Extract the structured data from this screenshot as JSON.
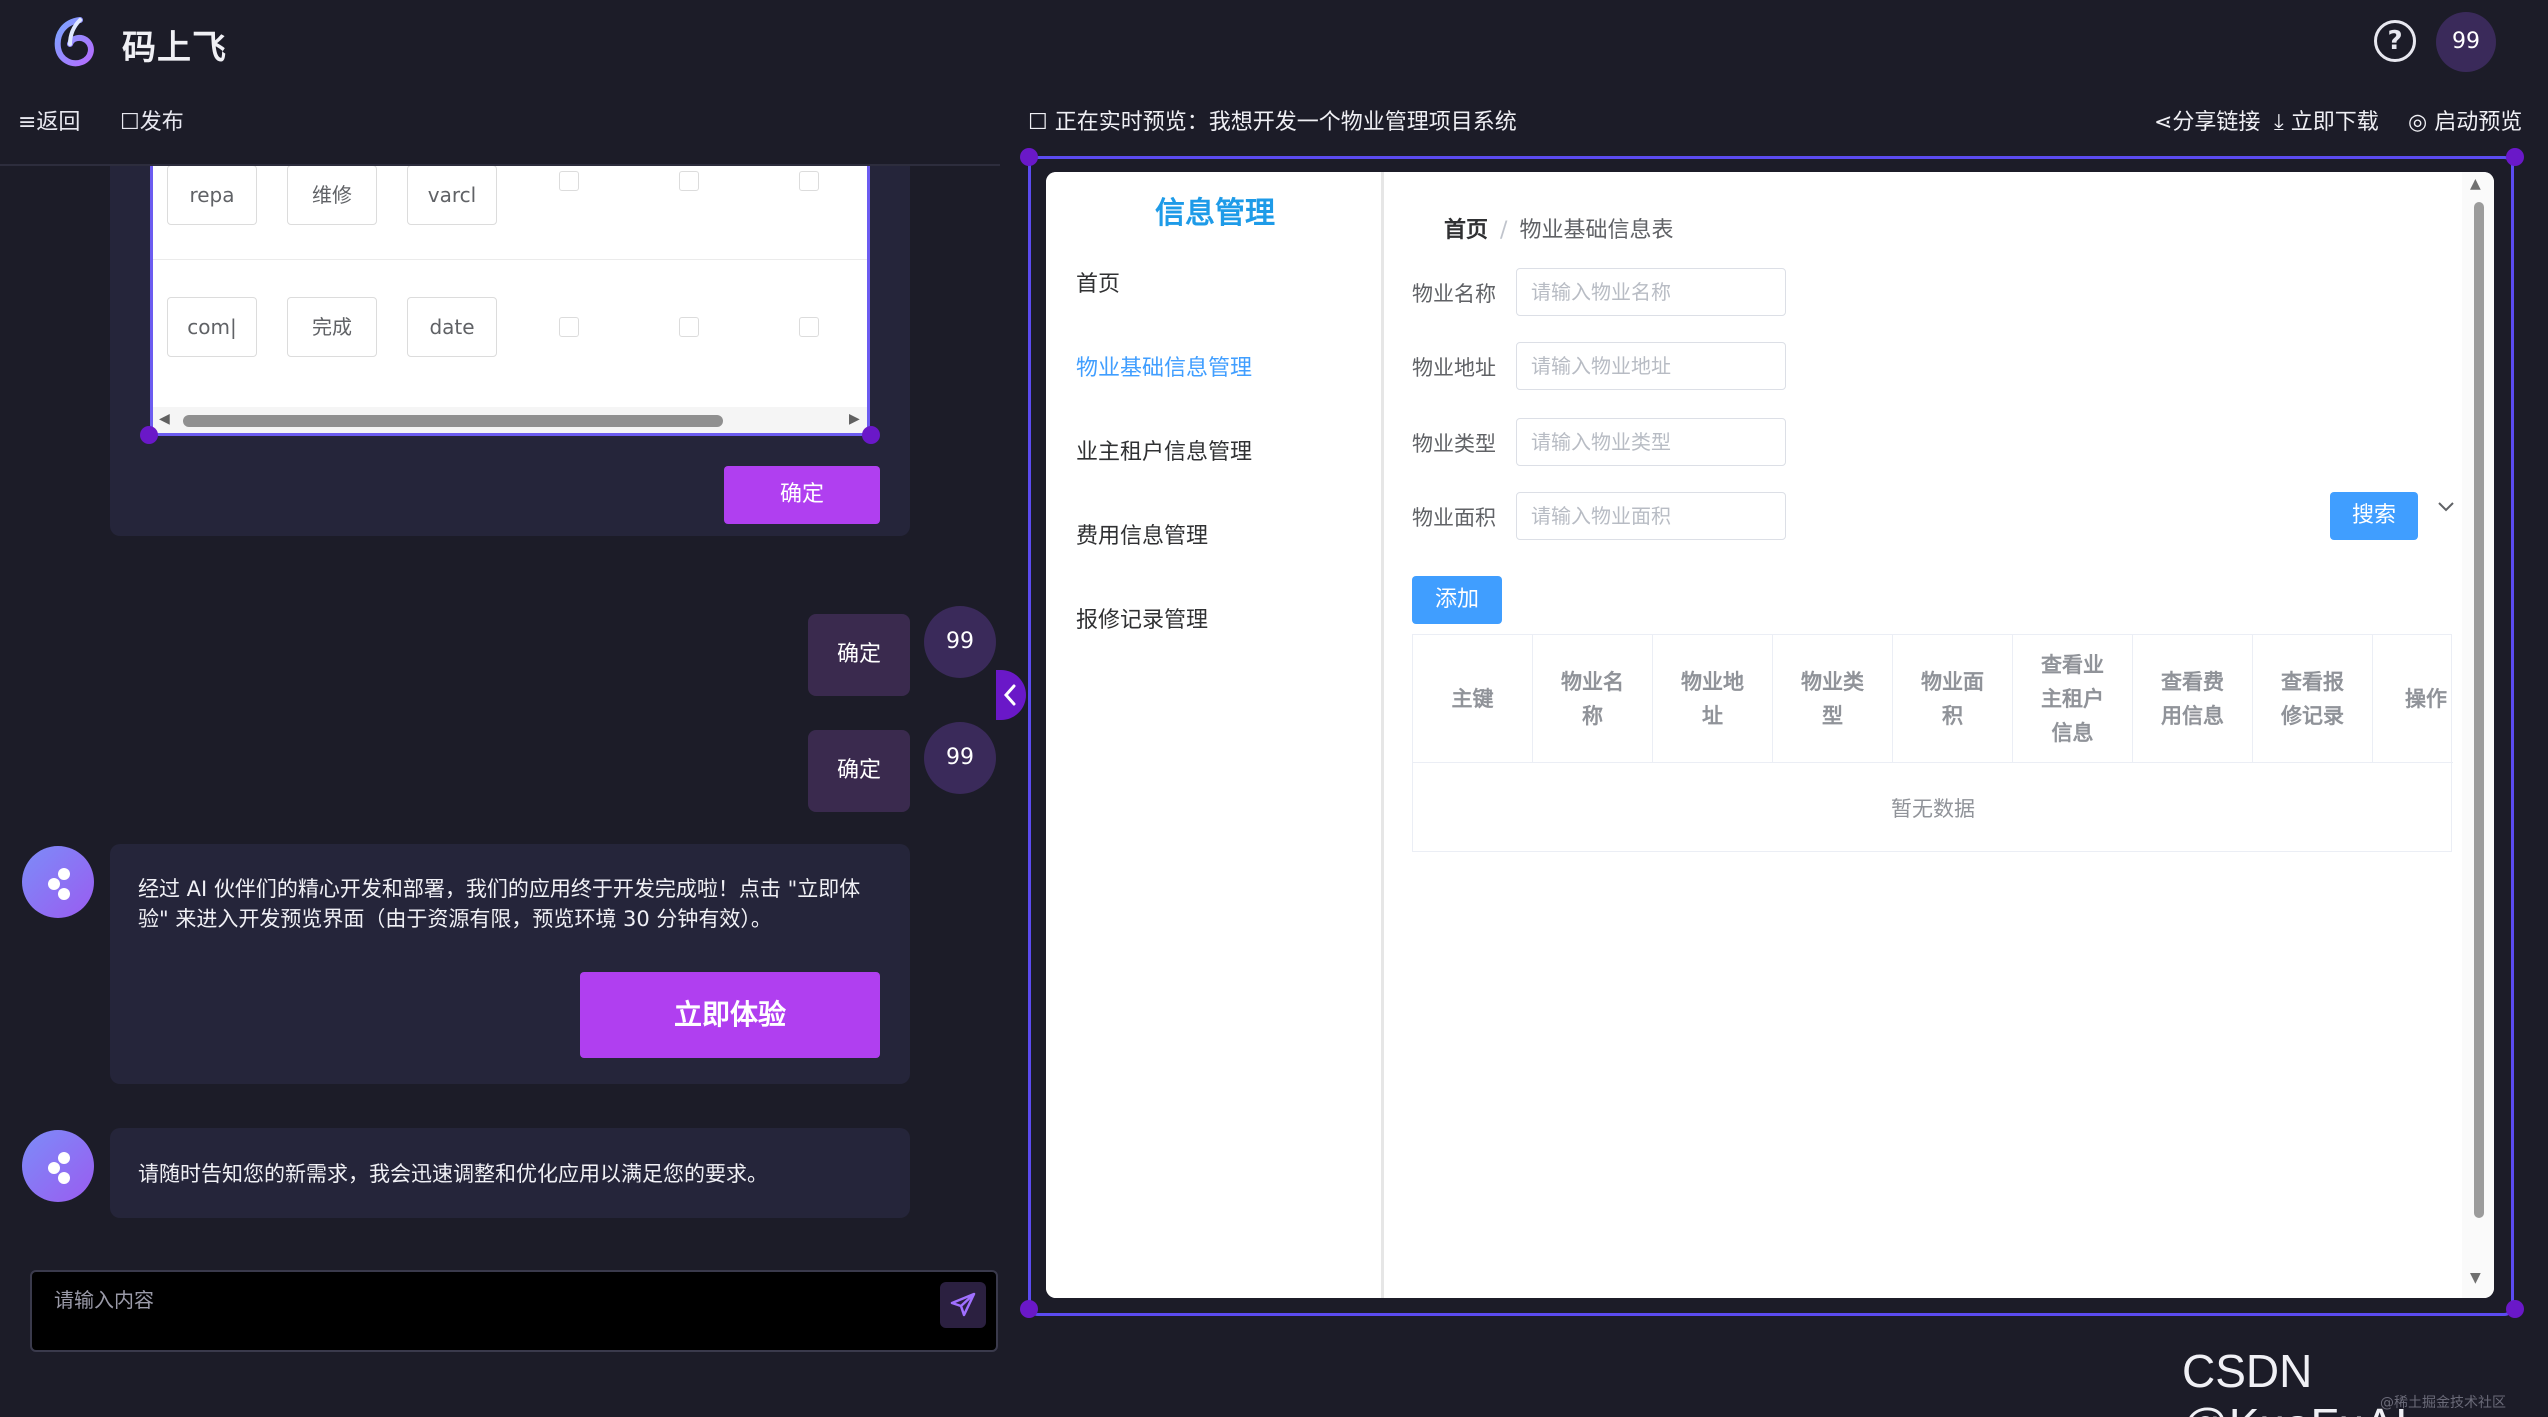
{
  "header": {
    "app_name": "码上飞",
    "help_glyph": "?",
    "user_avatar": "99"
  },
  "left_toolbar": {
    "back_label": "≡返回",
    "publish_label": "☐发布"
  },
  "chat": {
    "field_table": {
      "rows": [
        {
          "name": "repa",
          "label": "维修",
          "type": "varcl"
        },
        {
          "name": "com|",
          "label": "完成",
          "type": "date"
        }
      ],
      "confirm_label": "确定"
    },
    "user_messages": [
      {
        "text": "确定",
        "avatar": "99"
      },
      {
        "text": "确定",
        "avatar": "99"
      }
    ],
    "bot_messages": [
      {
        "text": "经过 AI 伙伴们的精心开发和部署，我们的应用终于开发完成啦！点击 \"立即体验\" 来进入开发预览界面（由于资源有限，预览环境 30 分钟有效）。",
        "button_label": "立即体验"
      },
      {
        "text": "请随时告知您的新需求，我会迅速调整和优化应用以满足您的要求。"
      }
    ],
    "input_placeholder": "请输入内容"
  },
  "preview_bar": {
    "title": "☐ 正在实时预览：我想开发一个物业管理项目系统",
    "share_label": "⋖分享链接",
    "download_label": "⤓ 立即下载",
    "start_label": "◎ 启动预览"
  },
  "preview_app": {
    "menu_title": "信息管理",
    "menu_items": [
      "首页",
      "物业基础信息管理",
      "业主租户信息管理",
      "费用信息管理",
      "报修记录管理"
    ],
    "active_menu_index": 1,
    "breadcrumb": {
      "home": "首页",
      "separator": "/",
      "current": "物业基础信息表"
    },
    "filters": [
      {
        "label": "物业名称",
        "placeholder": "请输入物业名称"
      },
      {
        "label": "物业地址",
        "placeholder": "请输入物业地址"
      },
      {
        "label": "物业类型",
        "placeholder": "请输入物业类型"
      },
      {
        "label": "物业面积",
        "placeholder": "请输入物业面积"
      }
    ],
    "search_label": "搜索",
    "add_label": "添加",
    "columns": [
      "主键",
      "物业名称",
      "物业地址",
      "物业类型",
      "物业面积",
      "查看业主租户信息",
      "查看费用信息",
      "查看报修记录",
      "操作"
    ],
    "empty_text": "暂无数据"
  },
  "watermark": {
    "main": "CSDN @KuaFuAI",
    "sub": "@稀土掘金技术社区"
  },
  "colors": {
    "background": "#1c1c28",
    "accent_purple": "#b03ff0",
    "frame_border": "#5b4bf0",
    "primary_blue": "#409eff",
    "menu_title": "#1e9be8"
  }
}
